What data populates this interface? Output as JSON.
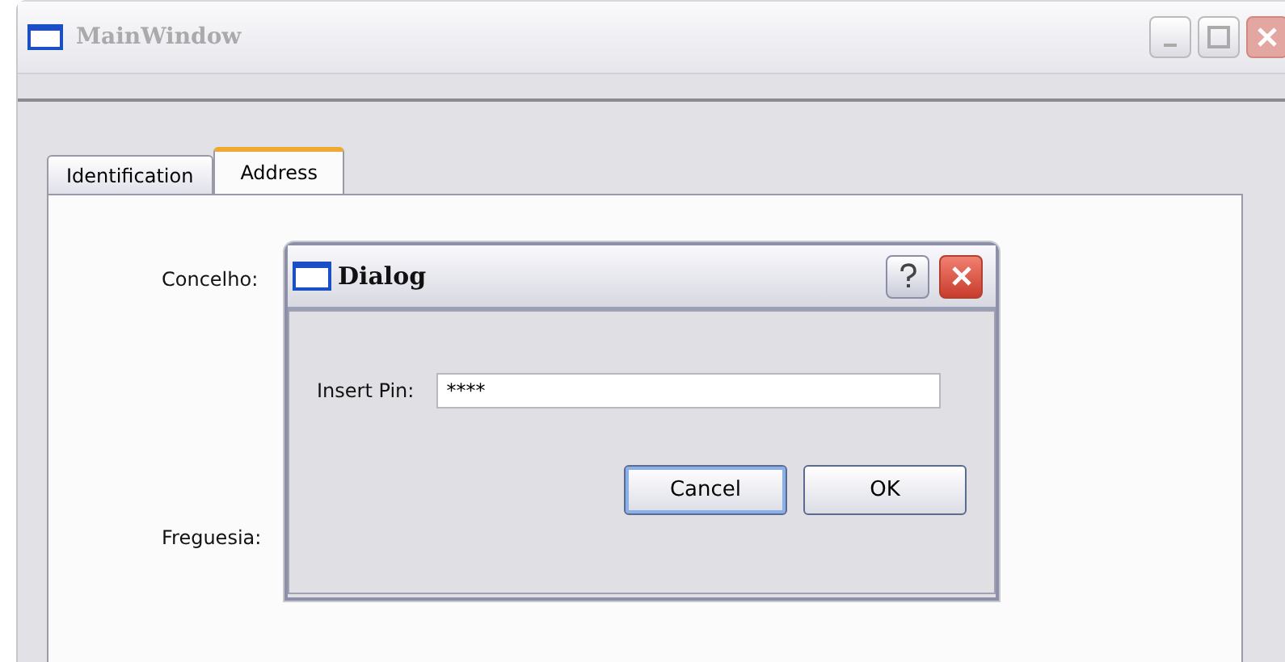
{
  "window": {
    "title": "MainWindow"
  },
  "tabs": [
    {
      "label": "Identification",
      "selected": false
    },
    {
      "label": "Address",
      "selected": true
    }
  ],
  "fields": [
    {
      "label": "Concelho:"
    },
    {
      "label": "Freguesia:"
    }
  ],
  "dialog": {
    "title": "Dialog",
    "pin_label": "Insert Pin:",
    "pin_value": "****",
    "buttons": [
      {
        "label": "Cancel",
        "kind": "focused"
      },
      {
        "label": "OK",
        "kind": "plain"
      }
    ]
  }
}
